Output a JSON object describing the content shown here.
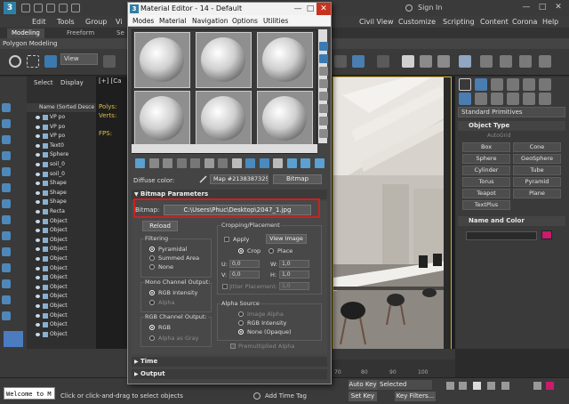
{
  "app": {
    "logo": "3",
    "signin": "Sign In",
    "menus": [
      "Edit",
      "Tools",
      "Group",
      "Vi",
      "Civil View",
      "Customize",
      "Scripting",
      "Content",
      "Corona",
      "Help"
    ],
    "ribbon_tabs": [
      "Modeling",
      "Freeform",
      "Se"
    ],
    "poly_modeling": "Polygon Modeling",
    "view_dropdown": "View",
    "win_controls": [
      "—",
      "□",
      "✕"
    ]
  },
  "explorer": {
    "tabs": [
      "Select",
      "Display"
    ],
    "header": "Name (Sorted Desce",
    "rows": [
      "VP po",
      "VP po",
      "VP po",
      "Text0",
      "Sphere",
      "soil_0",
      "soil_0",
      "Shape",
      "Shape",
      "Shape",
      "Recta",
      "Object",
      "Object",
      "Object",
      "Object",
      "Object",
      "Object",
      "Object",
      "Object",
      "Object",
      "Object",
      "Object",
      "Object",
      "Object"
    ]
  },
  "viewport": {
    "label": "[+] [Ca",
    "polys": "Polys:",
    "verts": "Verts:",
    "fps": "FPS:"
  },
  "command_panel": {
    "dropdown": "Standard Primitives",
    "object_type": "Object Type",
    "autogrid": "AutoGrid",
    "primitives": [
      "Box",
      "Cone",
      "Sphere",
      "GeoSphere",
      "Cylinder",
      "Tube",
      "Torus",
      "Pyramid",
      "Teapot",
      "Plane",
      "TextPlus"
    ],
    "name_and_color": "Name and Color",
    "swatch_color": "#c81c6c"
  },
  "timeline": {
    "ticks": [
      "70",
      "80",
      "90",
      "100"
    ]
  },
  "status": {
    "maxscript": "Welcome to M",
    "hint": "Click or click-and-drag to select objects",
    "add_time_tag": "Add Time Tag",
    "auto_key": "Auto Key",
    "set_key": "Set Key",
    "selected": "Selected",
    "key_filters": "Key Filters..."
  },
  "material_editor": {
    "title": "Material Editor - 14 - Default",
    "logo": "3",
    "menus": [
      "Modes",
      "Material",
      "Navigation",
      "Options",
      "Utilities"
    ],
    "diffuse_label": "Diffuse color:",
    "map_name": "Map #2138387325",
    "map_type": "Bitmap",
    "rollouts": {
      "bitmap_params": "Bitmap Parameters",
      "time": "Time",
      "output": "Output"
    },
    "bitmap_label": "Bitmap:",
    "bitmap_path": "C:\\Users\\Phuc\\Desktop\\2047_1.jpg",
    "reload": "Reload",
    "cropping": {
      "title": "Cropping/Placement",
      "apply": "Apply",
      "view_image": "View Image",
      "crop": "Crop",
      "place": "Place",
      "u_label": "U:",
      "u_val": "0,0",
      "v_label": "V:",
      "v_val": "0,0",
      "w_label": "W:",
      "w_val": "1,0",
      "h_label": "H:",
      "h_val": "1,0",
      "jitter": "Jitter Placement:",
      "jitter_val": "1,0"
    },
    "filtering": {
      "title": "Filtering",
      "options": [
        "Pyramidal",
        "Summed Area",
        "None"
      ],
      "selected": "Pyramidal"
    },
    "mono_channel": {
      "title": "Mono Channel Output:",
      "options": [
        "RGB Intensity",
        "Alpha"
      ],
      "selected": "RGB Intensity"
    },
    "rgb_channel": {
      "title": "RGB Channel Output:",
      "options": [
        "RGB",
        "Alpha as Gray"
      ],
      "selected": "RGB"
    },
    "alpha_source": {
      "title": "Alpha Source",
      "options": [
        "Image Alpha",
        "RGB Intensity",
        "None (Opaque)"
      ],
      "selected": "None (Opaque)"
    },
    "premultiplied": "Premultiplied Alpha"
  }
}
